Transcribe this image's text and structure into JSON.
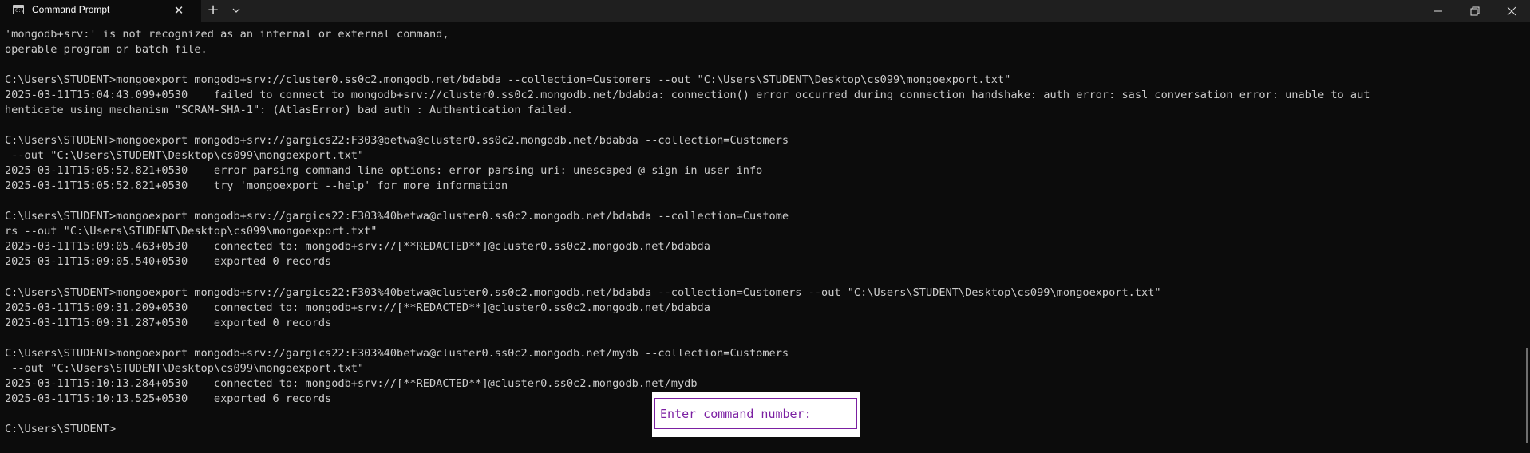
{
  "titlebar": {
    "tab_title": "Command Prompt",
    "tab_icon": "cmd-icon",
    "close_tab_icon": "close-icon",
    "new_tab_icon": "plus-icon",
    "dropdown_icon": "chevron-down-icon",
    "window_controls": [
      "minimize-icon",
      "restore-icon",
      "close-icon"
    ]
  },
  "terminal": {
    "lines": [
      "'mongodb+srv:' is not recognized as an internal or external command,",
      "operable program or batch file.",
      "",
      "C:\\Users\\STUDENT>mongoexport mongodb+srv://cluster0.ss0c2.mongodb.net/bdabda --collection=Customers --out \"C:\\Users\\STUDENT\\Desktop\\cs099\\mongoexport.txt\"",
      "2025-03-11T15:04:43.099+0530    failed to connect to mongodb+srv://cluster0.ss0c2.mongodb.net/bdabda: connection() error occurred during connection handshake: auth error: sasl conversation error: unable to aut",
      "henticate using mechanism \"SCRAM-SHA-1\": (AtlasError) bad auth : Authentication failed.",
      "",
      "C:\\Users\\STUDENT>mongoexport mongodb+srv://gargics22:F303@betwa@cluster0.ss0c2.mongodb.net/bdabda --collection=Customers",
      " --out \"C:\\Users\\STUDENT\\Desktop\\cs099\\mongoexport.txt\"",
      "2025-03-11T15:05:52.821+0530    error parsing command line options: error parsing uri: unescaped @ sign in user info",
      "2025-03-11T15:05:52.821+0530    try 'mongoexport --help' for more information",
      "",
      "C:\\Users\\STUDENT>mongoexport mongodb+srv://gargics22:F303%40betwa@cluster0.ss0c2.mongodb.net/bdabda --collection=Custome",
      "rs --out \"C:\\Users\\STUDENT\\Desktop\\cs099\\mongoexport.txt\"",
      "2025-03-11T15:09:05.463+0530    connected to: mongodb+srv://[**REDACTED**]@cluster0.ss0c2.mongodb.net/bdabda",
      "2025-03-11T15:09:05.540+0530    exported 0 records",
      "",
      "C:\\Users\\STUDENT>mongoexport mongodb+srv://gargics22:F303%40betwa@cluster0.ss0c2.mongodb.net/bdabda --collection=Customers --out \"C:\\Users\\STUDENT\\Desktop\\cs099\\mongoexport.txt\"",
      "2025-03-11T15:09:31.209+0530    connected to: mongodb+srv://[**REDACTED**]@cluster0.ss0c2.mongodb.net/bdabda",
      "2025-03-11T15:09:31.287+0530    exported 0 records",
      "",
      "C:\\Users\\STUDENT>mongoexport mongodb+srv://gargics22:F303%40betwa@cluster0.ss0c2.mongodb.net/mydb --collection=Customers",
      " --out \"C:\\Users\\STUDENT\\Desktop\\cs099\\mongoexport.txt\"",
      "2025-03-11T15:10:13.284+0530    connected to: mongodb+srv://[**REDACTED**]@cluster0.ss0c2.mongodb.net/mydb",
      "2025-03-11T15:10:13.525+0530    exported 6 records",
      "",
      "C:\\Users\\STUDENT>"
    ]
  },
  "overlay": {
    "label": "Enter command number:"
  },
  "colors": {
    "terminal_bg": "#0c0c0c",
    "terminal_fg": "#cccccc",
    "titlebar_bg": "#1f1f1f",
    "overlay_accent": "#7b1fa2"
  }
}
